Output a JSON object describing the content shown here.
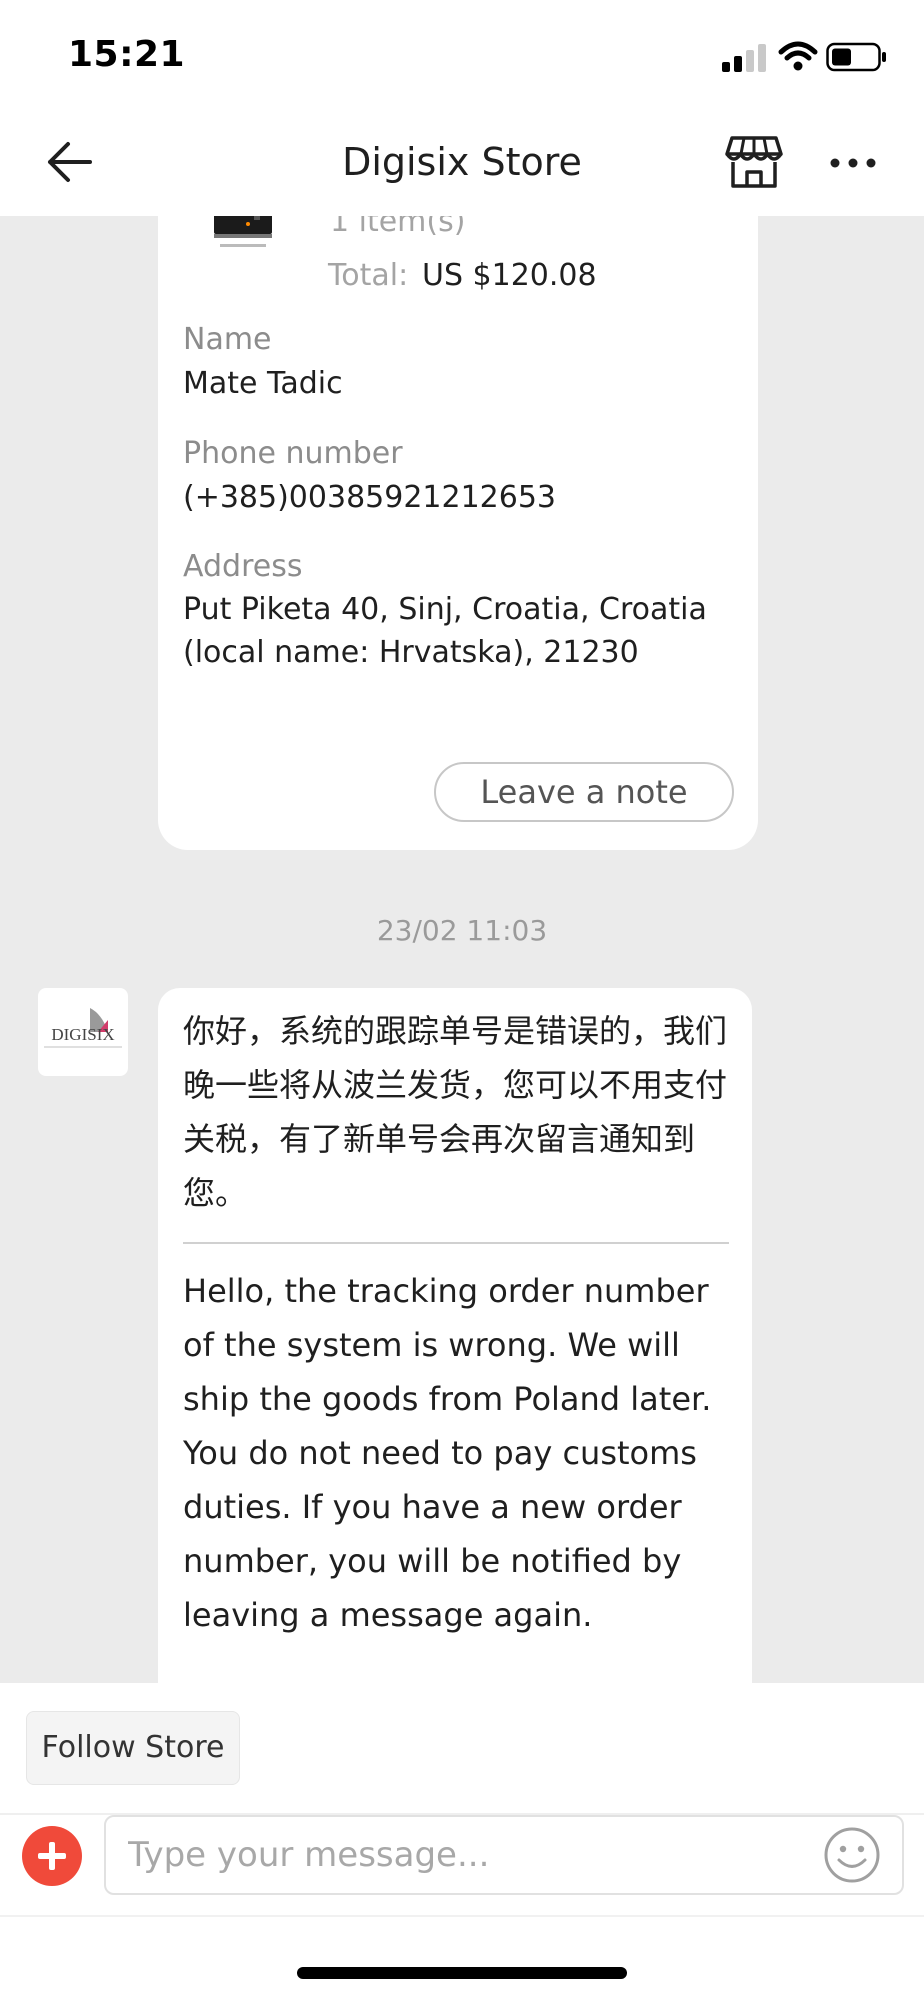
{
  "status_bar": {
    "time": "15:21"
  },
  "header": {
    "title": "Digisix Store",
    "back_icon": "arrow-left-icon",
    "store_icon": "store-icon",
    "more_icon": "more-horizontal-icon"
  },
  "order_card": {
    "items_count": "1 item(s)",
    "total_label": "Total:",
    "total_value": "US $120.08",
    "name_label": "Name",
    "name_value": "Mate Tadic",
    "phone_label": "Phone number",
    "phone_value": "(+385)00385921212653",
    "address_label": "Address",
    "address_value": "Put Piketa 40, Sinj, Croatia, Croatia (local name: Hrvatska), 21230",
    "leave_note_label": "Leave a note"
  },
  "chat": {
    "timestamp": "23/02 11:03",
    "avatar_text": "DIGISIX",
    "message_cn": "你好，系统的跟踪单号是错误的，我们晚一些将从波兰发货，您可以不用支付关税，有了新单号会再次留言通知到您。",
    "message_en": "Hello, the tracking order number of the system is wrong. We will ship the goods from Poland later. You do not need to pay customs duties. If you have a new order number, you will be notified by leaving a message again."
  },
  "bottom": {
    "follow_store_label": "Follow Store",
    "input_placeholder": "Type your message...",
    "add_icon": "plus-icon",
    "emoji_icon": "smiley-icon"
  },
  "colors": {
    "accent": "#f04a3a",
    "chat_background": "#ebebeb"
  }
}
